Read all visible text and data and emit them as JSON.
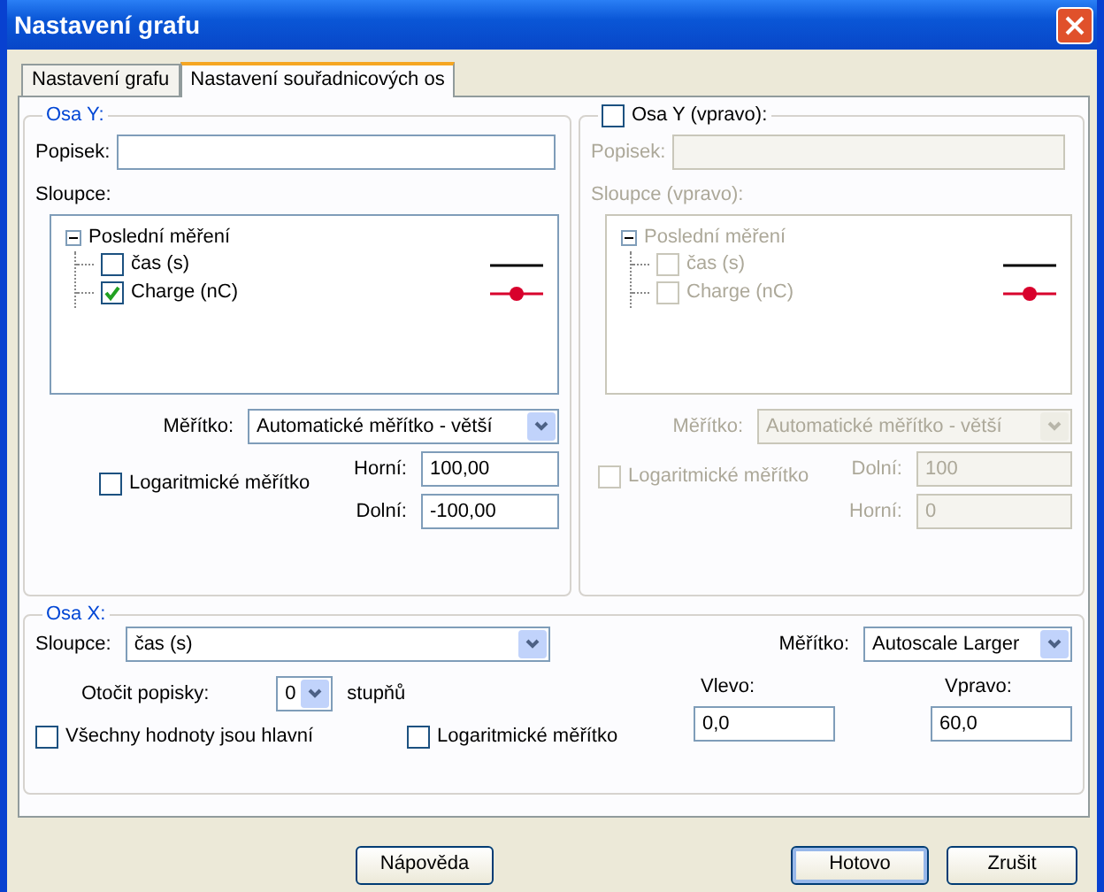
{
  "window": {
    "title": "Nastavení grafu"
  },
  "tabs": [
    {
      "label": "Nastavení grafu",
      "selected": false
    },
    {
      "label": "Nastavení souřadnicových os",
      "selected": true
    }
  ],
  "y_axis_left": {
    "title": "Osa Y:",
    "label_caption": "Popisek:",
    "columns_caption": "Sloupce:",
    "tree": {
      "label": "Poslední měření",
      "expanded": true,
      "children": [
        {
          "label": "čas (s)",
          "checked": false,
          "kind": "line",
          "color": "#000000"
        },
        {
          "label": "Charge (nC)",
          "checked": true,
          "kind": "line-marker",
          "color": "#d8002c"
        }
      ]
    },
    "scale_caption": "Měřítko:",
    "scale": "Automatické měřítko - větší",
    "log": {
      "label": "Logaritmické měřítko",
      "checked": false
    },
    "bounds": [
      {
        "caption": "Horní:",
        "value": "100,00"
      },
      {
        "caption": "Dolní:",
        "value": "-100,00"
      }
    ]
  },
  "y_axis_right": {
    "title": "Osa Y (vpravo):",
    "checked": false,
    "label_caption": "Popisek:",
    "columns_caption": "Sloupce (vpravo):",
    "tree": {
      "label": "Poslední měření",
      "expanded": true,
      "children": [
        {
          "label": "čas (s)",
          "checked": false,
          "kind": "line",
          "color": "#000000"
        },
        {
          "label": "Charge (nC)",
          "checked": false,
          "kind": "line-marker",
          "color": "#d8002c"
        }
      ]
    },
    "scale_caption": "Měřítko:",
    "scale": "Automatické měřítko - větší",
    "log": {
      "label": "Logaritmické měřítko",
      "checked": false
    },
    "bounds": [
      {
        "caption": "Dolní:",
        "value": "100"
      },
      {
        "caption": "Horní:",
        "value": "0"
      }
    ]
  },
  "x_axis": {
    "title": "Osa X:",
    "columns_caption": "Sloupce:",
    "column": "čas (s)",
    "scale_caption": "Měřítko:",
    "scale": "Autoscale Larger",
    "rotate_caption": "Otočit popisky:",
    "rotate": "0",
    "rotate_unit": "stupňů",
    "all_major": {
      "label": "Všechny hodnoty jsou hlavní",
      "checked": false
    },
    "log": {
      "label": "Logaritmické měřítko",
      "checked": false
    },
    "left": {
      "caption": "Vlevo:",
      "value": "0,0"
    },
    "right": {
      "caption": "Vpravo:",
      "value": "60,0"
    }
  },
  "buttons": [
    {
      "label": "Nápověda",
      "default": false
    },
    {
      "label": "Hotovo",
      "default": true
    },
    {
      "label": "Zrušit",
      "default": false
    }
  ]
}
